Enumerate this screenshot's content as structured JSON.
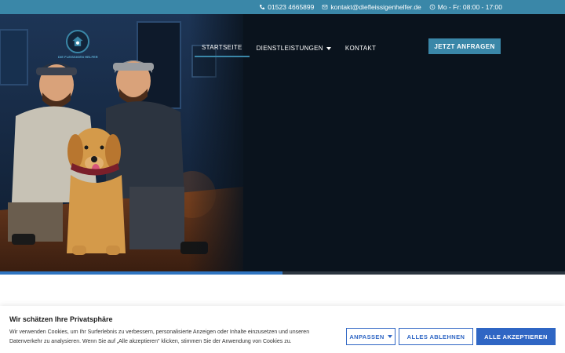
{
  "topbar": {
    "phone": "01523 4665899",
    "email": "kontakt@diefleissigenhelfer.de",
    "hours": "Mo - Fr: 08:00 - 17:00"
  },
  "logo": {
    "text": "DIE FLEISSIGEN HELFER"
  },
  "nav": {
    "items": [
      {
        "label": "STARTSEITE"
      },
      {
        "label": "DIENSTLEISTUNGEN"
      },
      {
        "label": "KONTAKT"
      }
    ],
    "cta": "JETZT ANFRAGEN"
  },
  "slider": {
    "progress": 0.5
  },
  "cookie": {
    "title": "Wir schätzen Ihre Privatsphäre",
    "text": "Wir verwenden Cookies, um Ihr Surferlebnis zu verbessern, personalisierte Anzeigen oder Inhalte einzusetzen und unseren Datenverkehr zu analysieren. Wenn Sie auf „Alle akzeptieren\" klicken, stimmen Sie der Anwendung von Cookies zu.",
    "customize": "ANPASSEN",
    "reject": "ALLES ABLEHNEN",
    "accept": "ALLE AKZEPTIEREN"
  },
  "colors": {
    "accent": "#3a87a8",
    "hero_bg": "#0a131d",
    "cookie_primary": "#2f66c4"
  }
}
